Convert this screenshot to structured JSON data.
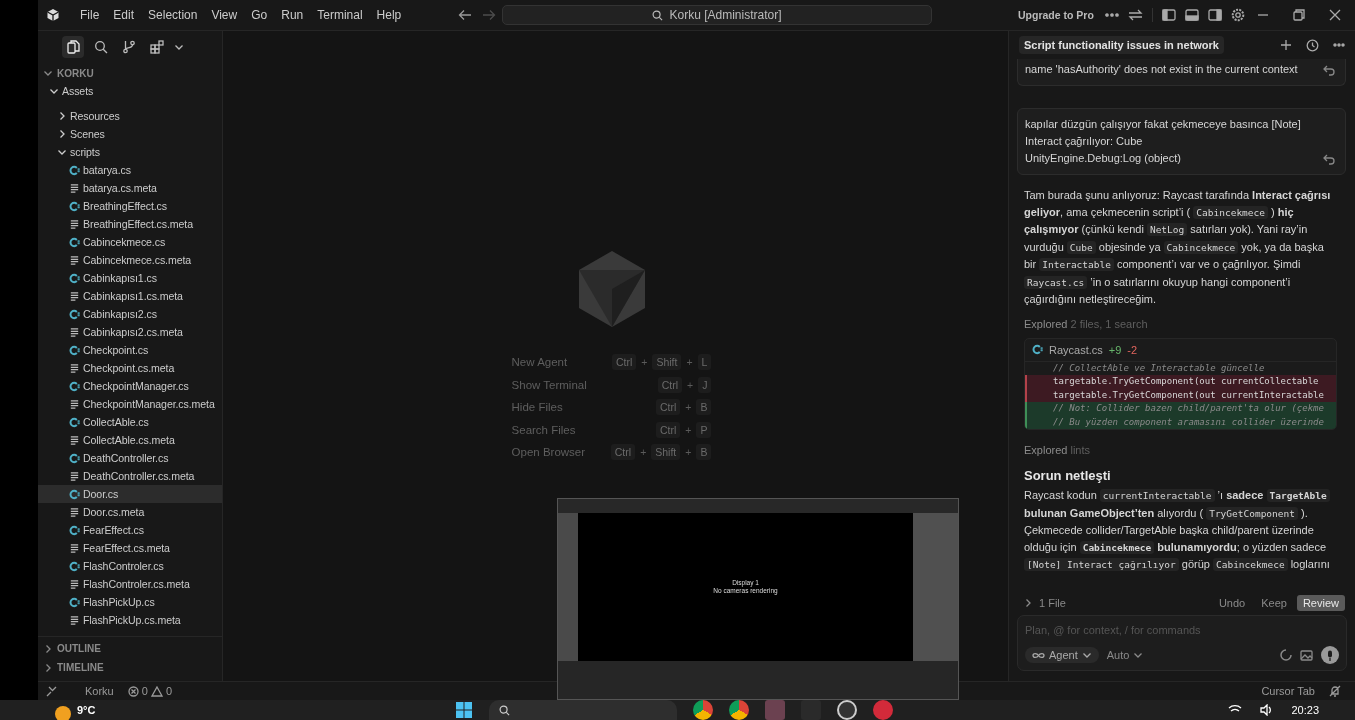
{
  "title_bar": {
    "menu": [
      "File",
      "Edit",
      "Selection",
      "View",
      "Go",
      "Run",
      "Terminal",
      "Help"
    ],
    "search": "Korku [Administrator]",
    "upgrade": "Upgrade to Pro"
  },
  "sidebar": {
    "activity": [
      {
        "kind": "explorer",
        "selected": true
      },
      {
        "kind": "search",
        "selected": false
      },
      {
        "kind": "source-control",
        "selected": false
      },
      {
        "kind": "extensions",
        "selected": false
      }
    ],
    "explorer": {
      "title": "KORKU",
      "expanded": true,
      "tree": [
        {
          "kind": "folder",
          "label": "Assets",
          "expanded": true,
          "selected": false,
          "children": [
            {
              "kind": "folder",
              "label": "Resources",
              "expanded": false,
              "selected": false
            },
            {
              "kind": "folder",
              "label": "Scenes",
              "expanded": false,
              "selected": false
            },
            {
              "kind": "folder",
              "label": "scripts",
              "expanded": true,
              "selected": false,
              "children": [
                {
                  "kind": "cs",
                  "label": "batarya.cs",
                  "selected": false
                },
                {
                  "kind": "meta",
                  "label": "batarya.cs.meta",
                  "selected": false
                },
                {
                  "kind": "cs",
                  "label": "BreathingEffect.cs",
                  "selected": false
                },
                {
                  "kind": "meta",
                  "label": "BreathingEffect.cs.meta",
                  "selected": false
                },
                {
                  "kind": "cs",
                  "label": "Cabincekmece.cs",
                  "selected": false
                },
                {
                  "kind": "meta",
                  "label": "Cabincekmece.cs.meta",
                  "selected": false
                },
                {
                  "kind": "cs",
                  "label": "Cabinkapısı1.cs",
                  "selected": false
                },
                {
                  "kind": "meta",
                  "label": "Cabinkapısı1.cs.meta",
                  "selected": false
                },
                {
                  "kind": "cs",
                  "label": "Cabinkapısı2.cs",
                  "selected": false
                },
                {
                  "kind": "meta",
                  "label": "Cabinkapısı2.cs.meta",
                  "selected": false
                },
                {
                  "kind": "cs",
                  "label": "Checkpoint.cs",
                  "selected": false
                },
                {
                  "kind": "meta",
                  "label": "Checkpoint.cs.meta",
                  "selected": false
                },
                {
                  "kind": "cs",
                  "label": "CheckpointManager.cs",
                  "selected": false
                },
                {
                  "kind": "meta",
                  "label": "CheckpointManager.cs.meta",
                  "selected": false
                },
                {
                  "kind": "cs",
                  "label": "CollectAble.cs",
                  "selected": false
                },
                {
                  "kind": "meta",
                  "label": "CollectAble.cs.meta",
                  "selected": false
                },
                {
                  "kind": "cs",
                  "label": "DeathController.cs",
                  "selected": false
                },
                {
                  "kind": "meta",
                  "label": "DeathController.cs.meta",
                  "selected": false
                },
                {
                  "kind": "cs",
                  "label": "Door.cs",
                  "selected": true
                },
                {
                  "kind": "meta",
                  "label": "Door.cs.meta",
                  "selected": false
                },
                {
                  "kind": "cs",
                  "label": "FearEffect.cs",
                  "selected": false
                },
                {
                  "kind": "meta",
                  "label": "FearEffect.cs.meta",
                  "selected": false
                },
                {
                  "kind": "cs",
                  "label": "FlashControler.cs",
                  "selected": false
                },
                {
                  "kind": "meta",
                  "label": "FlashControler.cs.meta",
                  "selected": false
                },
                {
                  "kind": "cs",
                  "label": "FlashPickUp.cs",
                  "selected": false
                },
                {
                  "kind": "meta",
                  "label": "FlashPickUp.cs.meta",
                  "selected": false
                }
              ]
            }
          ]
        }
      ]
    },
    "panels": [
      {
        "title": "OUTLINE",
        "expanded": false
      },
      {
        "title": "TIMELINE",
        "expanded": false
      }
    ]
  },
  "editor": {
    "shortcuts": [
      {
        "label": "New Agent",
        "keys": [
          "Ctrl",
          "+",
          "Shift",
          "+",
          "L"
        ]
      },
      {
        "label": "Show Terminal",
        "keys": [
          "Ctrl",
          "+",
          "J"
        ]
      },
      {
        "label": "Hide Files",
        "keys": [
          "Ctrl",
          "+",
          "B"
        ]
      },
      {
        "label": "Search Files",
        "keys": [
          "Ctrl",
          "+",
          "P"
        ]
      },
      {
        "label": "Open Browser",
        "keys": [
          "Ctrl",
          "+",
          "Shift",
          "+",
          "B"
        ]
      }
    ]
  },
  "chat": {
    "title": "Script functionality issues in network",
    "messages": [
      {
        "kind": "user",
        "lines": [
          "name 'hasAuthority' does not exist in the current context"
        ]
      },
      {
        "kind": "user",
        "lines": [
          "kapılar düzgün çalışıyor fakat çekmeceye basınca [Note]",
          "Interact çağrılıyor: Cube",
          "UnityEngine.Debug:Log (object)"
        ]
      },
      {
        "kind": "assistant",
        "segments": [
          {
            "kind": "text",
            "text": "Tam burada şunu anlıyoruz: Raycast tarafında "
          },
          {
            "kind": "bold",
            "text": "Interact çağrısı geliyor"
          },
          {
            "kind": "text",
            "text": ", ama çekmecenin script’i ( "
          },
          {
            "kind": "code",
            "text": "Cabincekmece"
          },
          {
            "kind": "text",
            "text": " ) "
          },
          {
            "kind": "bold",
            "text": "hiç çalışmıyor"
          },
          {
            "kind": "text",
            "text": " (çünkü kendi "
          },
          {
            "kind": "code",
            "text": "NetLog"
          },
          {
            "kind": "text",
            "text": " satırları yok). Yani ray’in vurduğu "
          },
          {
            "kind": "code",
            "text": "Cube"
          },
          {
            "kind": "text",
            "text": " objesinde ya "
          },
          {
            "kind": "code",
            "text": "Cabincekmece"
          },
          {
            "kind": "text",
            "text": " yok, ya da başka bir "
          },
          {
            "kind": "code",
            "text": "Interactable"
          },
          {
            "kind": "text",
            "text": " component’ı var ve o çağrılıyor. Şimdi "
          },
          {
            "kind": "code",
            "text": "Raycast.cs"
          },
          {
            "kind": "text",
            "text": " ’in o satırlarını okuyup hangi component’i çağırdığını netleştireceğim."
          }
        ]
      },
      {
        "kind": "explored",
        "label": "Explored",
        "detail": "2 files, 1 search"
      },
      {
        "kind": "diff",
        "file": "Raycast.cs",
        "added": "+9",
        "removed": "-2",
        "lines": [
          {
            "kind": "context",
            "text": "// CollectAble ve Interactable güncelle"
          },
          {
            "kind": "removed",
            "text": "targetable.TryGetComponent(out currentCollectable"
          },
          {
            "kind": "removed",
            "text": "targetable.TryGetComponent(out currentInteractable"
          },
          {
            "kind": "added",
            "text": "// Not: Collider bazen child/parent'ta olur (çekme"
          },
          {
            "kind": "added",
            "text": "// Bu yüzden component aramasını collider üzerinde"
          }
        ]
      },
      {
        "kind": "explored",
        "label": "Explored",
        "detail": "lints"
      },
      {
        "kind": "heading",
        "text": "Sorun netleşti"
      },
      {
        "kind": "assistant",
        "segments": [
          {
            "kind": "text",
            "text": "Raycast kodun "
          },
          {
            "kind": "code",
            "text": "currentInteractable"
          },
          {
            "kind": "text",
            "text": " ’ı "
          },
          {
            "kind": "bold",
            "text": "sadece "
          },
          {
            "kind": "boldcode",
            "text": "TargetAble"
          },
          {
            "kind": "bold",
            "text": " bulunan GameObject’ten"
          },
          {
            "kind": "text",
            "text": " alıyordu ( "
          },
          {
            "kind": "code",
            "text": "TryGetComponent"
          },
          {
            "kind": "text",
            "text": " ). Çekmecede collider/TargetAble başka child/parent üzerinde olduğu için "
          },
          {
            "kind": "boldcode",
            "text": "Cabincekmece"
          },
          {
            "kind": "bold",
            "text": " bulunamıyordu"
          },
          {
            "kind": "text",
            "text": "; o yüzden sadece "
          },
          {
            "kind": "code",
            "text": "[Note] Interact çağrılıyor"
          },
          {
            "kind": "text",
            "text": " görüp "
          },
          {
            "kind": "code",
            "text": "Cabincekmece"
          },
          {
            "kind": "text",
            "text": " loglarını"
          }
        ]
      }
    ],
    "changes": {
      "files": "1 File",
      "actions": [
        {
          "label": "Undo",
          "kind": "plain"
        },
        {
          "label": "Keep",
          "kind": "plain"
        },
        {
          "label": "Review",
          "kind": "primary"
        }
      ]
    },
    "composer": {
      "placeholder": "Plan, @ for context, / for commands",
      "mode": "Agent",
      "model": "Auto"
    }
  },
  "status_bar": {
    "project": "Korku",
    "errors": "0",
    "warnings": "0",
    "right": "Cursor Tab"
  },
  "taskbar": {
    "temperature": "9°C",
    "time": "20:23"
  },
  "preview": {
    "lines": [
      "Display 1",
      "No cameras rendering"
    ]
  }
}
